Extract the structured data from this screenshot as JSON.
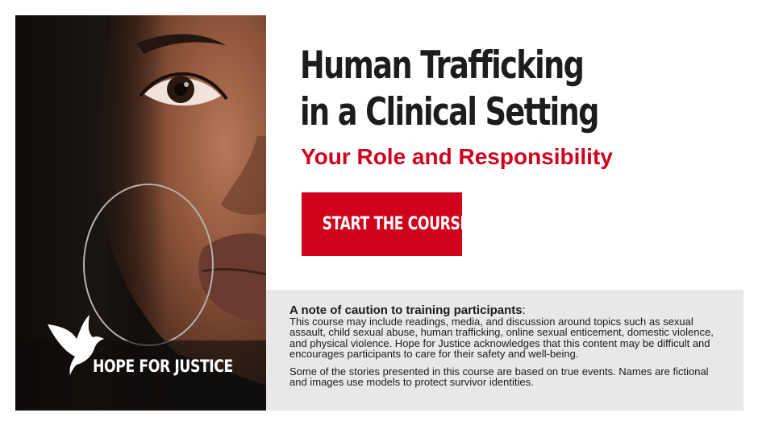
{
  "hero": {
    "title_line1": "Human Trafficking",
    "title_line2": "in a Clinical Setting",
    "subtitle": "Your Role and Responsibility",
    "cta_label": "START THE COURSE"
  },
  "logo": {
    "text": "HOPE FOR JUSTICE"
  },
  "caution": {
    "heading": "A note of caution to training participants",
    "heading_suffix": ":",
    "paragraph1": "This course may include readings, media, and discussion around topics such as sexual assault, child sexual abuse, human trafficking, online sexual enticement, domestic violence, and physical violence. Hope for Justice acknowledges that this content may be difficult and encourages participants to care for their safety and well-being.",
    "paragraph2": "Some of the stories presented in this course are based on true events. Names are fictional and images use models to protect survivor identities."
  },
  "colors": {
    "accent": "#d0021b",
    "caution_bg": "#e8e8e8",
    "title_text": "#1c1c1c"
  }
}
